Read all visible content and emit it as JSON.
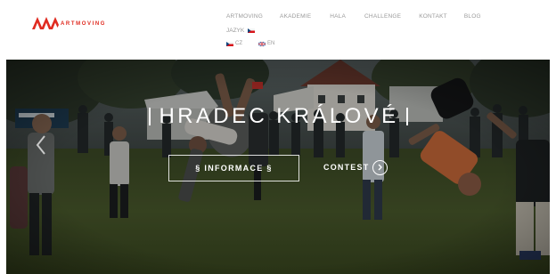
{
  "brand": {
    "mark_color": "#e02b20",
    "text_part1": "ART",
    "text_part2": "MOVING"
  },
  "nav": {
    "items": [
      {
        "label": "ARTMOVING"
      },
      {
        "label": "AKADEMIE"
      },
      {
        "label": "HALA"
      },
      {
        "label": "CHALLENGE"
      },
      {
        "label": "KONTAKT"
      },
      {
        "label": "BLOG"
      }
    ]
  },
  "language": {
    "label": "JAZYK",
    "current_flag": "flag-cz-icon",
    "options": [
      {
        "label": "CZ",
        "flag": "flag-cz-icon"
      },
      {
        "label": "EN",
        "flag": "flag-uk-icon"
      }
    ]
  },
  "hero": {
    "title": "HRADEC KRÁLOVÉ",
    "info_button": "§ INFORMACE §",
    "contest_link": "CONTEST",
    "contest_icon": "chevron-right-circle-icon",
    "prev_icon": "chevron-left-icon",
    "background": "photo-of-outdoor-parkour-event-on-grass"
  }
}
